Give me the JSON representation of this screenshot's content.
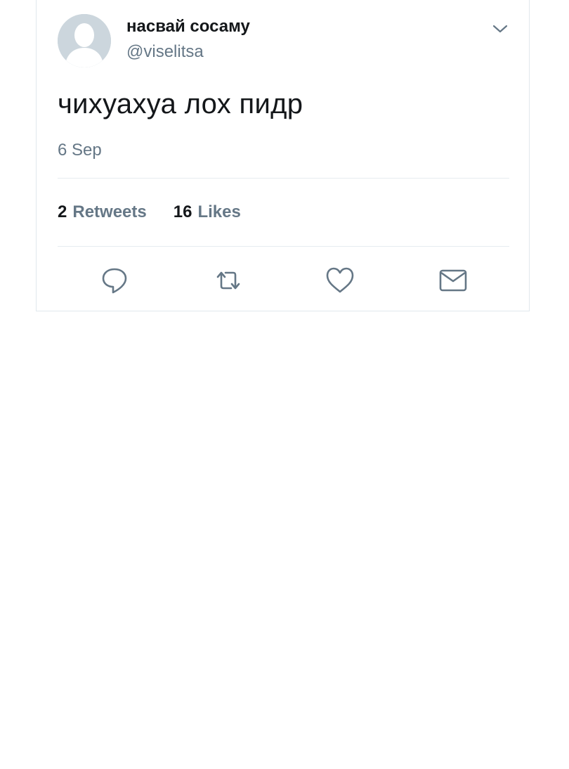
{
  "tweet": {
    "display_name": "насвай сосаму",
    "handle": "@viselitsa",
    "text": "чихуахуа лох пидр",
    "date": "6 Sep"
  },
  "stats": {
    "retweets_count": "2",
    "retweets_label": "Retweets",
    "likes_count": "16",
    "likes_label": "Likes"
  },
  "icons": {
    "avatar": "default-profile-silhouette",
    "menu": "chevron-down-icon",
    "actions": [
      "reply-icon",
      "retweet-icon",
      "like-icon",
      "message-icon"
    ]
  },
  "colors": {
    "primary_text": "#14171a",
    "secondary_text": "#657786",
    "icon": "#657786",
    "divider": "#e6ecf0",
    "avatar_bg": "#ccd6dd"
  }
}
